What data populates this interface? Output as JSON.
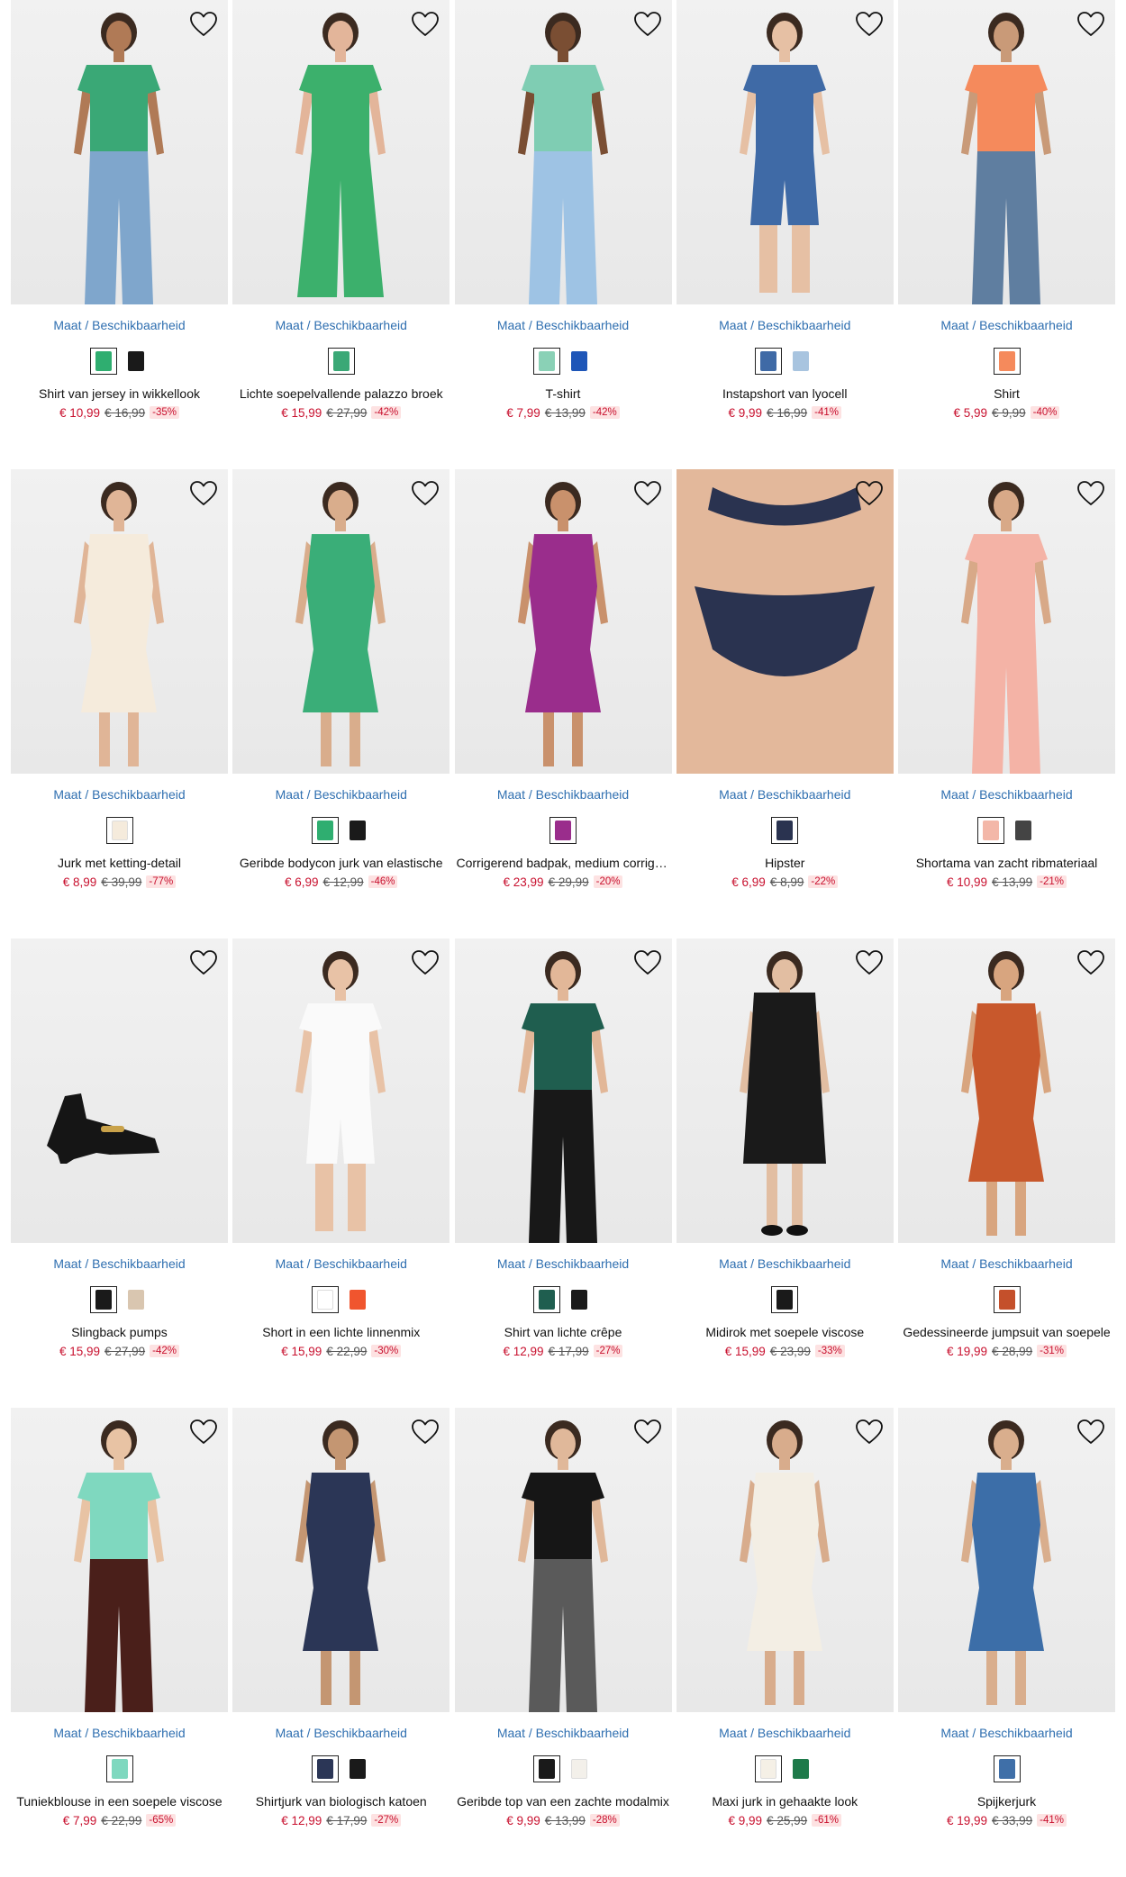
{
  "size_link_label": "Maat / Beschikbaarheid",
  "colors": {
    "sale": "#c8102e",
    "link": "#2f6fb0",
    "discount_bg": "#fde2e2"
  },
  "products": [
    {
      "title": "Shirt van jersey in wikkellook",
      "price": "€ 10,99",
      "old_price": "€ 16,99",
      "discount": "-35%",
      "swatches": [
        "#2fae70",
        "#1a1a1a"
      ],
      "garment": "#3aa876",
      "skin": "#b07a56",
      "bottom": "#7fa6cc",
      "kind": "top"
    },
    {
      "title": "Lichte soepelvallende palazzo broek",
      "price": "€ 15,99",
      "old_price": "€ 27,99",
      "discount": "-42%",
      "swatches": [
        "#3aa876"
      ],
      "garment": "#3cb06c",
      "skin": "#e3b59a",
      "bottom": "#3cb06c",
      "kind": "pants"
    },
    {
      "title": "T-shirt",
      "price": "€ 7,99",
      "old_price": "€ 13,99",
      "discount": "-42%",
      "swatches": [
        "#8ad1b6",
        "#1e56b8"
      ],
      "garment": "#7fcdb3",
      "skin": "#7a4e33",
      "bottom": "#9ec3e4",
      "kind": "tee"
    },
    {
      "title": "Instapshort van lyocell",
      "price": "€ 9,99",
      "old_price": "€ 16,99",
      "discount": "-41%",
      "swatches": [
        "#3f6aa6",
        "#a8c4df"
      ],
      "garment": "#3f6aa6",
      "skin": "#e6c0a4",
      "bottom": "#3f6aa6",
      "kind": "shorts"
    },
    {
      "title": "Shirt",
      "price": "€ 5,99",
      "old_price": "€ 9,99",
      "discount": "-40%",
      "swatches": [
        "#f58a5c"
      ],
      "garment": "#f58a5c",
      "skin": "#c99a78",
      "bottom": "#5f7ea0",
      "kind": "top"
    },
    {
      "title": "Jurk met ketting-detail",
      "price": "€ 8,99",
      "old_price": "€ 39,99",
      "discount": "-77%",
      "swatches": [
        "#f5ebdc"
      ],
      "garment": "#f5ebdc",
      "skin": "#e0b597",
      "bottom": "#f5ebdc",
      "kind": "dress"
    },
    {
      "title": "Geribde bodycon jurk van elastische",
      "price": "€ 6,99",
      "old_price": "€ 12,99",
      "discount": "-46%",
      "swatches": [
        "#2fae70",
        "#1a1a1a"
      ],
      "garment": "#3aae78",
      "skin": "#d9ad8c",
      "bottom": "#3aae78",
      "kind": "dress"
    },
    {
      "title": "Corrigerend badpak, medium corrigerend",
      "price": "€ 23,99",
      "old_price": "€ 29,99",
      "discount": "-20%",
      "swatches": [
        "#9a2d8c"
      ],
      "garment": "#9a2d8c",
      "skin": "#c9916c",
      "bottom": "#9a2d8c",
      "kind": "swim"
    },
    {
      "title": "Hipster",
      "price": "€ 6,99",
      "old_price": "€ 8,99",
      "discount": "-22%",
      "swatches": [
        "#2a3350"
      ],
      "garment": "#2a3350",
      "skin": "#e3b89b",
      "bottom": "#2a3350",
      "kind": "lingerie"
    },
    {
      "title": "Shortama van zacht ribmateriaal",
      "price": "€ 10,99",
      "old_price": "€ 13,99",
      "discount": "-21%",
      "swatches": [
        "#f3b7a8",
        "#444444"
      ],
      "garment": "#f4b3a6",
      "skin": "#d8a988",
      "bottom": "#f4b3a6",
      "kind": "top"
    },
    {
      "title": "Slingback pumps",
      "price": "€ 15,99",
      "old_price": "€ 27,99",
      "discount": "-42%",
      "swatches": [
        "#1a1a1a",
        "#d9c6b0"
      ],
      "garment": "#151515",
      "skin": "#f2f2f2",
      "bottom": "#151515",
      "kind": "shoe"
    },
    {
      "title": "Short in een lichte linnenmix",
      "price": "€ 15,99",
      "old_price": "€ 22,99",
      "discount": "-30%",
      "swatches": [
        "#ffffff",
        "#f0552e"
      ],
      "garment": "#fafafa",
      "skin": "#e8c2a6",
      "bottom": "#fafafa",
      "kind": "shorts"
    },
    {
      "title": "Shirt van lichte crêpe",
      "price": "€ 12,99",
      "old_price": "€ 17,99",
      "discount": "-27%",
      "swatches": [
        "#1f5e4f",
        "#1a1a1a"
      ],
      "garment": "#1f5e4f",
      "skin": "#e2b798",
      "bottom": "#181818",
      "kind": "top"
    },
    {
      "title": "Midirok met soepele viscose",
      "price": "€ 15,99",
      "old_price": "€ 23,99",
      "discount": "-33%",
      "swatches": [
        "#1a1a1a"
      ],
      "garment": "#1a1a1a",
      "skin": "#e2bea2",
      "bottom": "#1a1a1a",
      "kind": "skirt"
    },
    {
      "title": "Gedessineerde jumpsuit van soepele",
      "price": "€ 19,99",
      "old_price": "€ 28,99",
      "discount": "-31%",
      "swatches": [
        "#c4502b"
      ],
      "garment": "#c8582c",
      "skin": "#d8a57f",
      "bottom": "#c8582c",
      "kind": "dress"
    },
    {
      "title": "Tuniekblouse in een soepele viscose",
      "price": "€ 7,99",
      "old_price": "€ 22,99",
      "discount": "-65%",
      "swatches": [
        "#7fd8bf"
      ],
      "garment": "#7fd8bf",
      "skin": "#e8c3a4",
      "bottom": "#4a1f1a",
      "kind": "top"
    },
    {
      "title": "Shirtjurk van biologisch katoen",
      "price": "€ 12,99",
      "old_price": "€ 17,99",
      "discount": "-27%",
      "swatches": [
        "#2b3656",
        "#1a1a1a"
      ],
      "garment": "#2b3656",
      "skin": "#c49672",
      "bottom": "#2b3656",
      "kind": "dress"
    },
    {
      "title": "Geribde top van een zachte modalmix",
      "price": "€ 9,99",
      "old_price": "€ 13,99",
      "discount": "-28%",
      "swatches": [
        "#1a1a1a",
        "#f3f0ea"
      ],
      "garment": "#161616",
      "skin": "#e0b89a",
      "bottom": "#5a5a5a",
      "kind": "tee"
    },
    {
      "title": "Maxi jurk in gehaakte look",
      "price": "€ 9,99",
      "old_price": "€ 25,99",
      "discount": "-61%",
      "swatches": [
        "#f5f0e6",
        "#1e7a4a"
      ],
      "garment": "#f3eee4",
      "skin": "#d8ac8c",
      "bottom": "#f3eee4",
      "kind": "dress"
    },
    {
      "title": "Spijkerjurk",
      "price": "€ 19,99",
      "old_price": "€ 33,99",
      "discount": "-41%",
      "swatches": [
        "#3f6fa8"
      ],
      "garment": "#3c6ea8",
      "skin": "#d9ae8d",
      "bottom": "#3c6ea8",
      "kind": "dress"
    }
  ]
}
